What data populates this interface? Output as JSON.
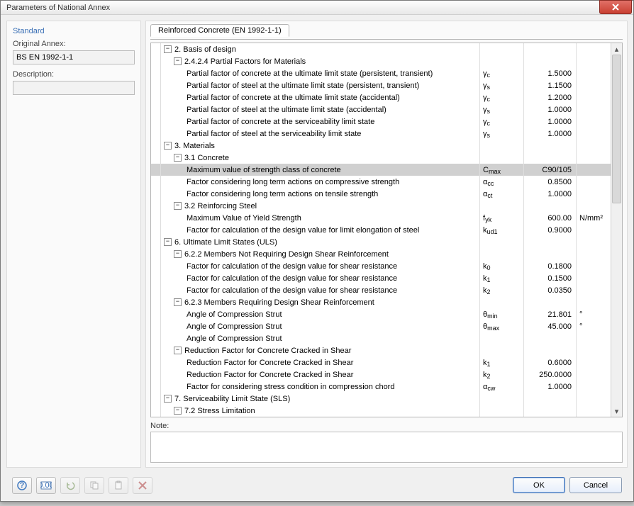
{
  "window_title": "Parameters of National Annex",
  "sidebar": {
    "heading": "Standard",
    "annex_label": "Original Annex:",
    "annex_value": "BS EN 1992-1-1",
    "desc_label": "Description:",
    "desc_value": ""
  },
  "tab": "Reinforced Concrete (EN 1992-1-1)",
  "note_label": "Note:",
  "buttons": {
    "ok": "OK",
    "cancel": "Cancel"
  },
  "rows": [
    {
      "lvl": 1,
      "t": true,
      "label": "2. Basis of design"
    },
    {
      "lvl": 2,
      "t": true,
      "label": "2.4.2.4 Partial Factors for Materials"
    },
    {
      "lvl": 3,
      "label": "Partial factor of concrete at the ultimate limit state (persistent, transient)",
      "sym": "γ<sub>c</sub>",
      "val": "1.5000"
    },
    {
      "lvl": 3,
      "label": "Partial factor of steel at the ultimate limit state (persistent, transient)",
      "sym": "γ<sub>s</sub>",
      "val": "1.1500"
    },
    {
      "lvl": 3,
      "label": "Partial factor of concrete at the ultimate limit state (accidental)",
      "sym": "γ<sub>c</sub>",
      "val": "1.2000"
    },
    {
      "lvl": 3,
      "label": "Partial factor of steel at the ultimate limit state (accidental)",
      "sym": "γ<sub>s</sub>",
      "val": "1.0000"
    },
    {
      "lvl": 3,
      "label": "Partial factor of concrete at the serviceability limit state",
      "sym": "γ<sub>c</sub>",
      "val": "1.0000"
    },
    {
      "lvl": 3,
      "label": "Partial factor of steel at the serviceability limit state",
      "sym": "γ<sub>s</sub>",
      "val": "1.0000"
    },
    {
      "lvl": 1,
      "t": true,
      "label": "3. Materials"
    },
    {
      "lvl": 2,
      "t": true,
      "label": "3.1 Concrete"
    },
    {
      "lvl": 3,
      "label": "Maximum value of strength class of concrete",
      "sym": "C<sub>max</sub>",
      "val": "C90/105",
      "hi": true
    },
    {
      "lvl": 3,
      "label": "Factor considering long term actions on compressive strength",
      "sym": "α<sub>cc</sub>",
      "val": "0.8500"
    },
    {
      "lvl": 3,
      "label": "Factor considering long term actions on tensile strength",
      "sym": "α<sub>ct</sub>",
      "val": "1.0000"
    },
    {
      "lvl": 2,
      "t": true,
      "label": "3.2 Reinforcing Steel"
    },
    {
      "lvl": 3,
      "label": "Maximum Value of Yield Strength",
      "sym": "f<sub>yk</sub>",
      "val": "600.00",
      "unit": "N/mm²"
    },
    {
      "lvl": 3,
      "label": "Factor for calculation of the design value for limit elongation of steel",
      "sym": "k<sub>ud1</sub>",
      "val": "0.9000"
    },
    {
      "lvl": 1,
      "t": true,
      "label": "6. Ultimate Limit States (ULS)"
    },
    {
      "lvl": 2,
      "t": true,
      "label": "6.2.2 Members Not Requiring Design Shear Reinforcement"
    },
    {
      "lvl": 3,
      "label": "Factor for calculation of the design value for shear resistance",
      "sym": "k<sub>0</sub>",
      "val": "0.1800"
    },
    {
      "lvl": 3,
      "label": "Factor for calculation of the design value for shear resistance",
      "sym": "k<sub>1</sub>",
      "val": "0.1500"
    },
    {
      "lvl": 3,
      "label": "Factor for calculation of the design value for shear resistance",
      "sym": "k<sub>2</sub>",
      "val": "0.0350"
    },
    {
      "lvl": 2,
      "t": true,
      "label": "6.2.3 Members Requiring Design Shear Reinforcement"
    },
    {
      "lvl": 3,
      "label": "Angle of Compression Strut",
      "sym": "θ<sub>min</sub>",
      "val": "21.801",
      "unit": "°"
    },
    {
      "lvl": 3,
      "label": "Angle of Compression Strut",
      "sym": "θ<sub>max</sub>",
      "val": "45.000",
      "unit": "°"
    },
    {
      "lvl": 3,
      "label": "Angle of Compression Strut"
    },
    {
      "lvl": 2,
      "t": true,
      "label": "Reduction Factor for Concrete Cracked in Shear"
    },
    {
      "lvl": 3,
      "label": "Reduction Factor for Concrete Cracked in Shear",
      "sym": "k<sub>1</sub>",
      "val": "0.6000"
    },
    {
      "lvl": 3,
      "label": "Reduction Factor for Concrete Cracked in Shear",
      "sym": "k<sub>2</sub>",
      "val": "250.0000"
    },
    {
      "lvl": 3,
      "label": "Factor for considering stress condition in compression chord",
      "sym": "α<sub>cw</sub>",
      "val": "1.0000"
    },
    {
      "lvl": 1,
      "t": true,
      "label": "7. Serviceability Limit State (SLS)"
    },
    {
      "lvl": 2,
      "t": true,
      "label": "7.2 Stress Limitation"
    }
  ]
}
